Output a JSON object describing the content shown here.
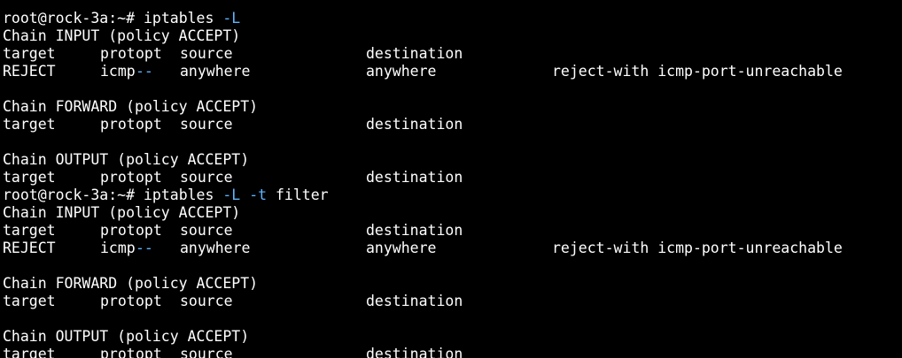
{
  "colors": {
    "background": "#000000",
    "text": "#ffffff",
    "option_highlight": "#5fb3ff"
  },
  "prompt": "root@rock-3a:~#",
  "commands": [
    {
      "base": "iptables",
      "flag1": "-L",
      "flag2": "",
      "arg": ""
    },
    {
      "base": "iptables",
      "flag1": "-L",
      "flag2": "-t",
      "arg": "filter"
    }
  ],
  "header": {
    "target": "target",
    "prot": "prot",
    "opt": "opt",
    "source": "source",
    "destination": "destination"
  },
  "chains": {
    "input": "Chain INPUT (policy ACCEPT)",
    "forward": "Chain FORWARD (policy ACCEPT)",
    "output": "Chain OUTPUT (policy ACCEPT)"
  },
  "reject_rule": {
    "target": "REJECT",
    "prot": "icmp",
    "opt": "--",
    "source": "anywhere",
    "destination": "anywhere",
    "extra": "reject-with icmp-port-unreachable"
  }
}
